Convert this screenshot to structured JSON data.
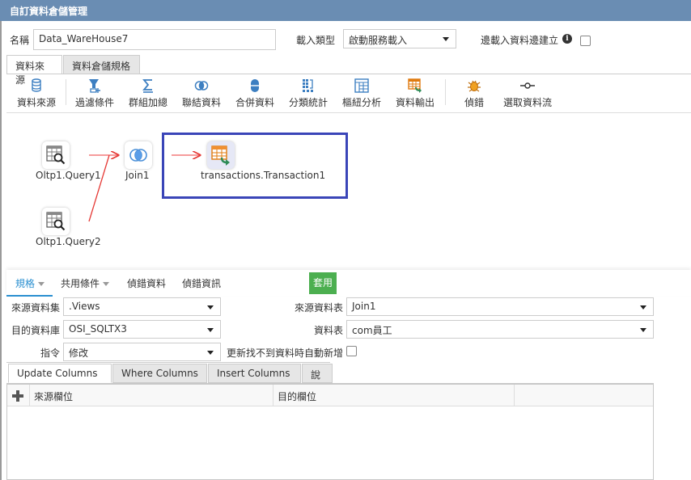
{
  "window": {
    "title": "自訂資料倉儲管理"
  },
  "header": {
    "name_label": "名稱",
    "name_value": "Data_WareHouse7",
    "load_type_label": "載入類型",
    "load_type_value": "啟動服務載入",
    "while_load_label": "邊載入資料邊建立",
    "while_load_checked": false
  },
  "top_tabs": [
    {
      "label": "資料來源",
      "active": true
    },
    {
      "label": "資料倉儲規格",
      "active": false
    }
  ],
  "toolbar": {
    "items": [
      {
        "label": "資料來源",
        "icon": "database-icon"
      },
      {
        "label": "過濾條件",
        "icon": "filter-add-icon"
      },
      {
        "label": "群組加總",
        "icon": "sigma-icon"
      },
      {
        "label": "聯結資料",
        "icon": "join-icon"
      },
      {
        "label": "合併資料",
        "icon": "merge-icon"
      },
      {
        "label": "分類統計",
        "icon": "category-stats-icon"
      },
      {
        "label": "樞紐分析",
        "icon": "pivot-icon"
      },
      {
        "label": "資料輸出",
        "icon": "table-export-icon"
      },
      {
        "label": "偵錯",
        "icon": "bug-icon"
      },
      {
        "label": "選取資料流",
        "icon": "select-flow-icon"
      }
    ]
  },
  "flow": {
    "nodes": [
      {
        "id": "q1",
        "label": "Oltp1.Query1",
        "icon": "query-table-icon"
      },
      {
        "id": "q2",
        "label": "Oltp1.Query2",
        "icon": "query-table-icon"
      },
      {
        "id": "join",
        "label": "Join1",
        "icon": "join-icon"
      },
      {
        "id": "out",
        "label": "transactions.Transaction1",
        "icon": "table-export-icon",
        "selected": true
      }
    ],
    "edges": [
      {
        "from": "q1",
        "to": "join"
      },
      {
        "from": "q2",
        "to": "join"
      },
      {
        "from": "join",
        "to": "out"
      }
    ],
    "edge_color": "#e53935",
    "selection_color": "#3a45b8"
  },
  "bottom_tabs": [
    {
      "label": "規格",
      "active": true,
      "dropdown": true
    },
    {
      "label": "共用條件",
      "active": false,
      "dropdown": true
    },
    {
      "label": "偵錯資料",
      "active": false,
      "dropdown": false
    },
    {
      "label": "偵錯資訊",
      "active": false,
      "dropdown": false
    }
  ],
  "apply_button": "套用",
  "form": {
    "source_dataset_label": "來源資料集",
    "source_dataset_value": ".Views",
    "target_db_label": "目的資料庫",
    "target_db_value": "OSI_SQLTX3",
    "command_label": "指令",
    "command_value": "修改",
    "source_table_label": "來源資料表",
    "source_table_value": "Join1",
    "table_label": "資料表",
    "table_value": "com員工",
    "auto_insert_label": "更新找不到資料時自動新增",
    "auto_insert_checked": false
  },
  "column_tabs": [
    {
      "label": "Update Columns",
      "active": true
    },
    {
      "label": "Where Columns",
      "active": false
    },
    {
      "label": "Insert Columns",
      "active": false
    },
    {
      "label": "說明",
      "active": false
    }
  ],
  "grid": {
    "columns": [
      "來源欄位",
      "目的欄位",
      ""
    ],
    "rows": []
  },
  "colors": {
    "titlebar": "#6a8db3",
    "accent": "#2a8fd0",
    "apply": "#4caf50"
  }
}
